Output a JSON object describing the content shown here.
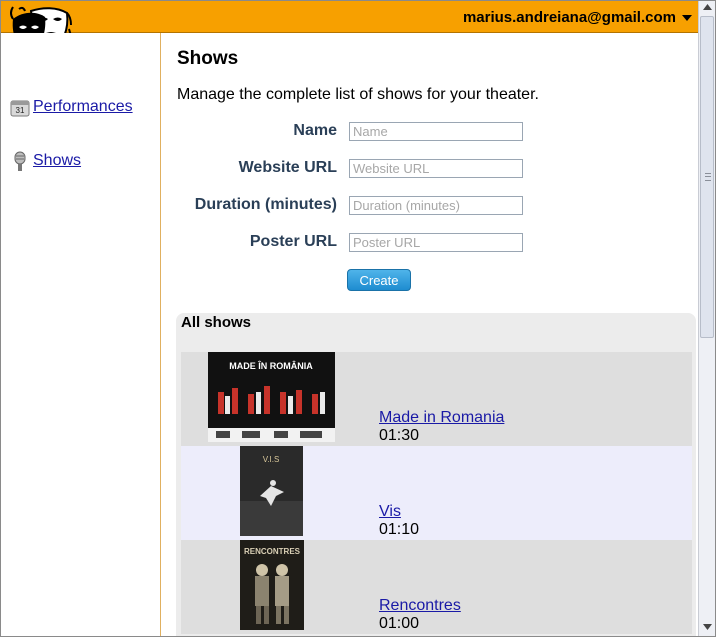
{
  "header": {
    "account_email": "marius.andreiana@gmail.com",
    "brand_color": "#f7a000"
  },
  "sidebar": {
    "items": [
      {
        "label": "Performances",
        "icon": "calendar-icon",
        "calendar_day": "31"
      },
      {
        "label": "Shows",
        "icon": "microphone-icon"
      }
    ]
  },
  "main": {
    "title": "Shows",
    "description": "Manage the complete list of shows for your theater.",
    "form": {
      "fields": [
        {
          "label": "Name",
          "placeholder": "Name"
        },
        {
          "label": "Website URL",
          "placeholder": "Website URL"
        },
        {
          "label": "Duration (minutes)",
          "placeholder": "Duration (minutes)"
        },
        {
          "label": "Poster URL",
          "placeholder": "Poster URL"
        }
      ],
      "create_label": "Create"
    },
    "shows_panel": {
      "title": "All shows",
      "shows": [
        {
          "name": "Made in Romania",
          "duration": "01:30",
          "poster_text": [
            "MADE ÎN ROMÂNIA"
          ]
        },
        {
          "name": "Vis",
          "duration": "01:10",
          "poster_text": [
            "V.I.S"
          ]
        },
        {
          "name": "Rencontres",
          "duration": "01:00",
          "poster_text": [
            "RENCONTRES"
          ]
        }
      ]
    }
  }
}
